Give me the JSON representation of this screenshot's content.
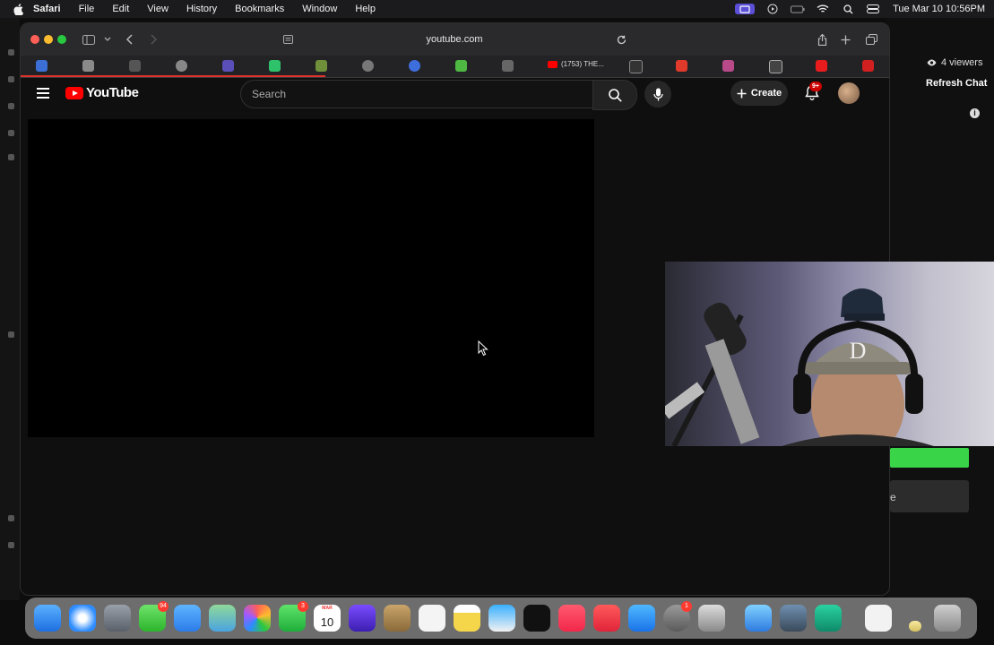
{
  "menubar": {
    "app_name": "Safari",
    "items": [
      "File",
      "Edit",
      "View",
      "History",
      "Bookmarks",
      "Window",
      "Help"
    ],
    "clock": "Tue Mar 10  10:56PM"
  },
  "browser": {
    "url": "youtube.com",
    "active_tab_label": "(1753) THE..."
  },
  "youtube": {
    "logo_text": "YouTube",
    "search_placeholder": "Search",
    "create_label": "Create",
    "notification_count": "9+"
  },
  "stream_panel": {
    "viewers": "4 viewers",
    "refresh_chat": "Refresh Chat",
    "button_partial_text": "e"
  },
  "dock": {
    "messages_badge": "94",
    "facetime_badge": "3",
    "calendar_month": "MAR",
    "calendar_day": "10",
    "settings_badge": "1"
  },
  "colors": {
    "youtube_red": "#ff0000",
    "accent_green": "#39d447",
    "menubar_bg": "#1b1b1d"
  }
}
